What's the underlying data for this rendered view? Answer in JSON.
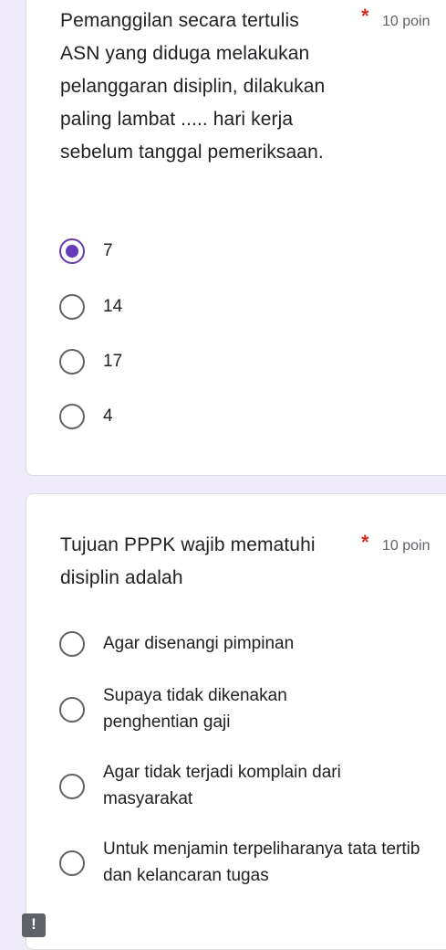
{
  "question1": {
    "title": "Pemanggilan secara tertulis ASN yang diduga melakukan pelanggaran disiplin, dilakukan paling lambat ..... hari kerja sebelum tanggal pemeriksaan.",
    "required_marker": "*",
    "points": "10 poin",
    "selected_option": "7",
    "options": [
      "7",
      "14",
      "17",
      "4"
    ]
  },
  "question2": {
    "title": "Tujuan PPPK wajib mematuhi disiplin adalah",
    "required_marker": "*",
    "points": "10 poin",
    "options": [
      "Agar disenangi pimpinan",
      "Supaya tidak dikenakan penghentian gaji",
      "Agar tidak terjadi komplain dari masyarakat",
      "Untuk menjamin terpeliharanya tata tertib dan kelancaran tugas"
    ]
  },
  "footer": {
    "badge_text": "!"
  },
  "colors": {
    "accent": "#673ab7",
    "required": "#d93025",
    "background": "#f0ebf8"
  }
}
